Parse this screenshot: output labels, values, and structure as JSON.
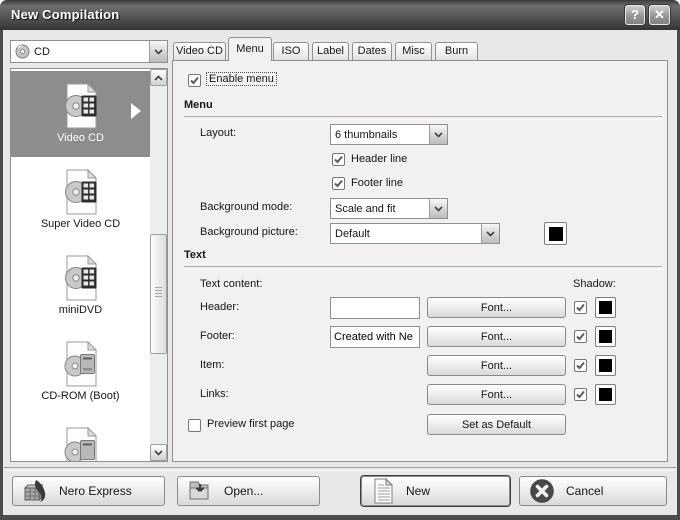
{
  "window": {
    "title": "New Compilation",
    "help_button": "?",
    "close_button": "✕"
  },
  "sidebar": {
    "media_combo": {
      "value": "CD"
    },
    "compilation_list": [
      {
        "label": "Video CD",
        "selected": true
      },
      {
        "label": "Super Video CD",
        "selected": false
      },
      {
        "label": "miniDVD",
        "selected": false
      },
      {
        "label": "CD-ROM (Boot)",
        "selected": false
      },
      {
        "label": "",
        "selected": false
      }
    ]
  },
  "tabs": [
    {
      "label": "Video CD",
      "active": false
    },
    {
      "label": "Menu",
      "active": true
    },
    {
      "label": "ISO",
      "active": false
    },
    {
      "label": "Label",
      "active": false
    },
    {
      "label": "Dates",
      "active": false
    },
    {
      "label": "Misc",
      "active": false
    },
    {
      "label": "Burn",
      "active": false
    }
  ],
  "menu_tab": {
    "enable_menu": {
      "label": "Enable menu",
      "checked": true
    },
    "menu_group": {
      "title": "Menu",
      "layout": {
        "label": "Layout:",
        "value": "6 thumbnails"
      },
      "header_line": {
        "label": "Header line",
        "checked": true
      },
      "footer_line": {
        "label": "Footer line",
        "checked": true
      },
      "background_mode": {
        "label": "Background mode:",
        "value": "Scale and fit"
      },
      "background_picture": {
        "label": "Background picture:",
        "value": "Default",
        "color": "#000000"
      }
    },
    "text_group": {
      "title": "Text",
      "text_content_label": "Text content:",
      "shadow_label": "Shadow:",
      "header_row": {
        "label": "Header:",
        "value": "",
        "font_button": "Font...",
        "shadow_checked": true,
        "color": "#000000"
      },
      "footer_row": {
        "label": "Footer:",
        "value": "Created with Ne",
        "font_button": "Font...",
        "shadow_checked": true,
        "color": "#000000"
      },
      "item_row": {
        "label": "Item:",
        "font_button": "Font...",
        "shadow_checked": true,
        "color": "#000000"
      },
      "links_row": {
        "label": "Links:",
        "font_button": "Font...",
        "shadow_checked": true,
        "color": "#000000"
      },
      "preview_first_page": {
        "label": "Preview first page",
        "checked": false
      },
      "set_as_default": "Set as Default"
    }
  },
  "footer": {
    "nero_express": "Nero Express",
    "open": "Open...",
    "new": "New",
    "cancel": "Cancel"
  },
  "colors": {
    "titlebar": "#4a4a4a",
    "selection": "#8d8d8d",
    "swatch_black": "#000000"
  }
}
